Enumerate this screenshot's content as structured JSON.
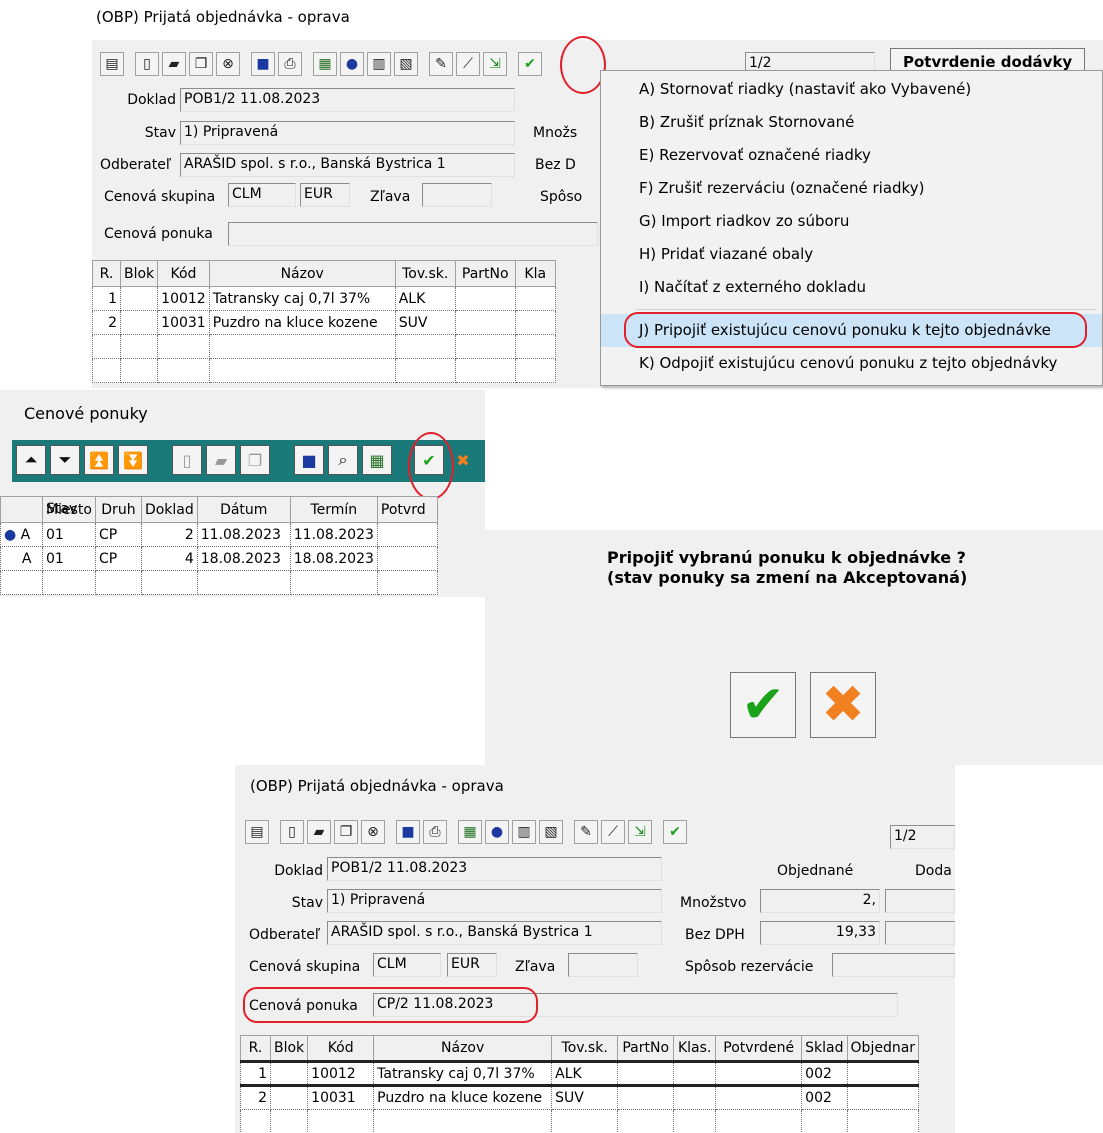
{
  "window1": {
    "title": "(OBP) Prijatá objednávka - oprava",
    "toolbar_icons": [
      "clipboard-icon",
      "new-doc-icon",
      "open-folder-icon",
      "copy-icon",
      "delete-icon",
      "monitor-icon",
      "print-icon",
      "grid-icon",
      "dot-icon",
      "form-icon",
      "form2-icon",
      "edit-doc-icon",
      "magic-wand-icon",
      "export-icon",
      "checkmark-icon"
    ],
    "page_field": "1/2",
    "confirm_button": "Potvrdenie dodávky",
    "doklad_label": "Doklad",
    "doklad_value": "POB1/2 11.08.2023",
    "stav_label": "Stav",
    "stav_value": "1) Pripravená",
    "odberatel_label": "Odberateľ",
    "odberatel_value": "ARAŠID spol. s r.o., Banská Bystrica 1",
    "cenova_skupina_label": "Cenová skupina",
    "cenova_skupina_value": "CLM",
    "currency": "EUR",
    "zlava_label": "Zľava",
    "cenova_ponuka_label": "Cenová ponuka",
    "mnozstvo_partial": "Množs",
    "bez_dph_partial": "Bez D",
    "sposob_partial": "Spôso",
    "columns": [
      "R.",
      "Blok",
      "Kód",
      "Názov",
      "Tov.sk.",
      "PartNo",
      "Kla"
    ],
    "rows": [
      [
        "1",
        "",
        "10012",
        "Tatransky caj 0,7l 37%",
        "ALK",
        "",
        ""
      ],
      [
        "2",
        "",
        "10031",
        "Puzdro na kluce kozene",
        "SUV",
        "",
        ""
      ]
    ]
  },
  "menu": {
    "items": [
      "A) Stornovať riadky (nastaviť ako Vybavené)",
      "B) Zrušiť príznak Stornované",
      "E) Rezervovať označené riadky",
      "F) Zrušiť rezerváciu (označené riadky)",
      "G) Import riadkov zo súboru",
      "H) Pridať viazané obaly",
      "I) Načítať z externého dokladu",
      "J) Pripojiť existujúcu cenovú ponuku k tejto objednávke",
      "K) Odpojiť existujúcu cenovú ponuku z tejto objednávky"
    ],
    "highlighted": 7,
    "highlight_color": "#cce4f7"
  },
  "window2": {
    "title": "Cenové ponuky",
    "toolbar_icons": [
      "move-up-icon",
      "move-down-icon",
      "move-top-icon",
      "move-bottom-icon",
      "new-doc-icon",
      "open-folder-icon",
      "copy-icon",
      "monitor-icon",
      "search-icon",
      "grid-icon",
      "checkmark-icon",
      "cancel-icon"
    ],
    "toolbar_color": "#1a7a7a",
    "columns": [
      "Stav",
      "Miesto",
      "Druh",
      "Doklad",
      "Dátum",
      "Termín",
      "Potvrd"
    ],
    "rows": [
      [
        "A",
        "01",
        "CP",
        "2",
        "11.08.2023",
        "11.08.2023",
        ""
      ],
      [
        "A",
        "01",
        "CP",
        "4",
        "18.08.2023",
        "18.08.2023",
        ""
      ]
    ]
  },
  "dialog": {
    "message_line1": "Pripojiť vybranú ponuku k objednávke ?",
    "message_line2": "(stav ponuky sa zmení na Akceptovaná)"
  },
  "window3": {
    "title": "(OBP) Prijatá objednávka - oprava",
    "page_field": "1/2",
    "doklad_label": "Doklad",
    "doklad_value": "POB1/2 11.08.2023",
    "stav_label": "Stav",
    "stav_value": "1) Pripravená",
    "odberatel_label": "Odberateľ",
    "odberatel_value": "ARAŠID spol. s r.o., Banská Bystrica 1",
    "cenova_skupina_label": "Cenová skupina",
    "cenova_skupina_value": "CLM",
    "currency": "EUR",
    "zlava_label": "Zľava",
    "objednane_header": "Objednané",
    "doda_header": "Doda",
    "mnozstvo_label": "Množstvo",
    "mnozstvo_value": "2,",
    "bez_dph_label": "Bez DPH",
    "bez_dph_value": "19,33",
    "sposob_label": "Spôsob rezervácie",
    "cenova_ponuka_label": "Cenová ponuka",
    "cenova_ponuka_value": "CP/2 11.08.2023",
    "columns": [
      "R.",
      "Blok",
      "Kód",
      "Názov",
      "Tov.sk.",
      "PartNo",
      "Klas.",
      "Potvrdené",
      "Sklad",
      "Objednar"
    ],
    "rows": [
      [
        "1",
        "",
        "10012",
        "Tatransky caj 0,7l 37%",
        "ALK",
        "",
        "",
        "",
        "002",
        ""
      ],
      [
        "2",
        "",
        "10031",
        "Puzdro na kluce kozene",
        "SUV",
        "",
        "",
        "",
        "002",
        ""
      ]
    ]
  }
}
